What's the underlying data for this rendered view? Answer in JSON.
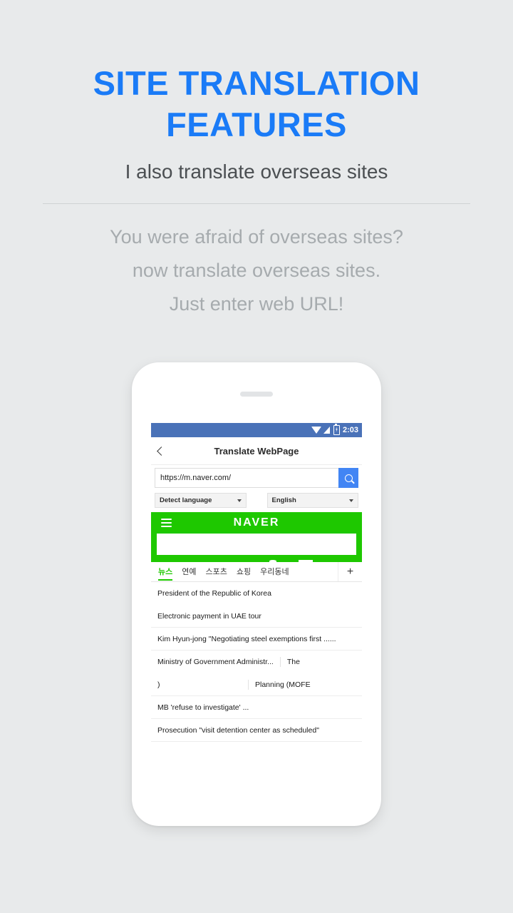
{
  "promo": {
    "title": "SITE TRANSLATION FEATURES",
    "subtitle": "I also translate overseas sites",
    "body_line1": "You were afraid of overseas sites?",
    "body_line2": "now translate overseas sites.",
    "body_line3": "Just enter web URL!",
    "accent_color": "#1a7bf7",
    "background_color": "#e8eaeb"
  },
  "phone": {
    "statusbar": {
      "time": "2:03",
      "wifi_icon": "wifi-icon",
      "signal_icon": "signal-icon",
      "battery_icon": "battery-charging-icon",
      "background_color": "#4a72b8"
    },
    "toolbar": {
      "back_icon": "back-chevron-icon",
      "title": "Translate WebPage"
    },
    "url_bar": {
      "value": "https://m.naver.com/",
      "placeholder": "Enter web URL",
      "go_icon": "search-icon",
      "go_color": "#4285f4"
    },
    "language": {
      "source": "Detect language",
      "target": "English",
      "caret_icon": "caret-down-icon"
    },
    "naver": {
      "menu_icon": "hamburger-menu-icon",
      "logo": "NAVER",
      "brand_color": "#1ec800",
      "search_value": "",
      "tabs": [
        {
          "label": "뉴스",
          "active": true
        },
        {
          "label": "연예",
          "active": false
        },
        {
          "label": "스포츠",
          "active": false
        },
        {
          "label": "쇼핑",
          "active": false
        },
        {
          "label": "우리동네",
          "active": false
        }
      ],
      "add_tab_label": "+",
      "news": [
        {
          "type": "single",
          "text": "President of the Republic of Korea",
          "divider": false
        },
        {
          "type": "single",
          "text": "Electronic payment in UAE tour",
          "divider": true
        },
        {
          "type": "single",
          "text": "Kim Hyun-jong \"Negotiating steel exemptions first ......",
          "divider": true
        },
        {
          "type": "split",
          "left": "Ministry of Government Administr...",
          "right": "The",
          "divider": false
        },
        {
          "type": "split",
          "left": ")",
          "right": "Planning (MOFE",
          "divider": true
        },
        {
          "type": "single",
          "text": "MB 'refuse to investigate' ...",
          "divider": true
        },
        {
          "type": "single",
          "text": "Prosecution \"visit detention center as scheduled\"",
          "divider": true
        }
      ]
    }
  }
}
